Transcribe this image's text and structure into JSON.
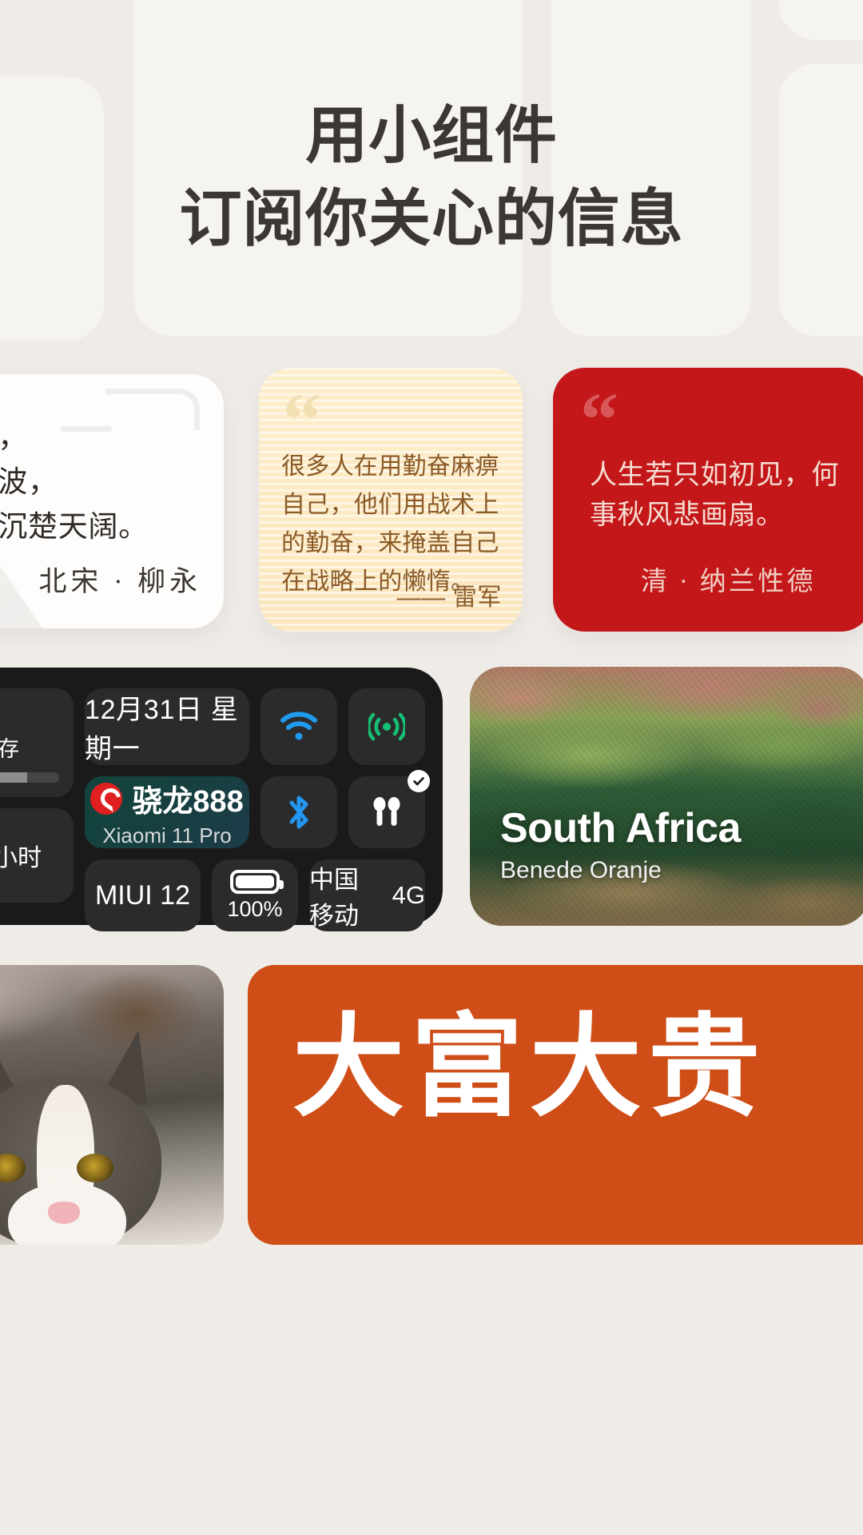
{
  "hero": {
    "headline_line1": "用小组件",
    "headline_line2": "订阅你关心的信息"
  },
  "poem_card": {
    "line1": "念去去，",
    "line2": "千里烟波，",
    "line3": "暮霭沉沉楚天阔。",
    "author": "北宋 · 柳永",
    "icons": {
      "cloud": "cloud-motif-icon",
      "mountain": "mountain-motif-icon"
    }
  },
  "yellow_quote_card": {
    "quote_mark": "“",
    "text": "很多人在用勤奋麻痹自己，他们用战术上的勤奋，来掩盖自己在战略上的懒惰。",
    "author": "—— 雷军",
    "bg_color": "#fdeecb",
    "text_color": "#8a5a27"
  },
  "red_quote_card": {
    "quote_mark": "“",
    "text": "人生若只如初见，何事秋风悲画扇。",
    "author": "清 · 纳兰性德",
    "bg_color": "#c3171a",
    "text_color": "#f6dcd0"
  },
  "miui_panel": {
    "storage_label": "储存",
    "storage_percent": 62,
    "hours_label": "小时",
    "date": "12月31日  星期一",
    "wifi_icon": "wifi-icon",
    "signal_icon": "cellular-signal-icon",
    "bluetooth_icon": "bluetooth-icon",
    "earbuds_icon": "earbuds-icon",
    "earbuds_connected_icon": "check-badge-icon",
    "soc_name": "骁龙888",
    "soc_logo_icon": "snapdragon-logo-icon",
    "device_name": "Xiaomi 11 Pro",
    "os_version": "MIUI 12",
    "battery_icon": "battery-full-icon",
    "battery_percent": "100%",
    "carrier": "中国移动",
    "network_type": "4G",
    "accent_wifi": "#1f9bf0",
    "accent_signal": "#17c076",
    "accent_bluetooth": "#2196f3",
    "panel_bg": "#1a1a1a"
  },
  "map_card": {
    "title": "South Africa",
    "subtitle": "Benede Oranje",
    "image_name": "satellite-imagery-south-africa"
  },
  "photo_card": {
    "image_name": "cat-photo"
  },
  "fortune_card": {
    "text": "大富大贵",
    "bg_color": "#cf4e18"
  }
}
